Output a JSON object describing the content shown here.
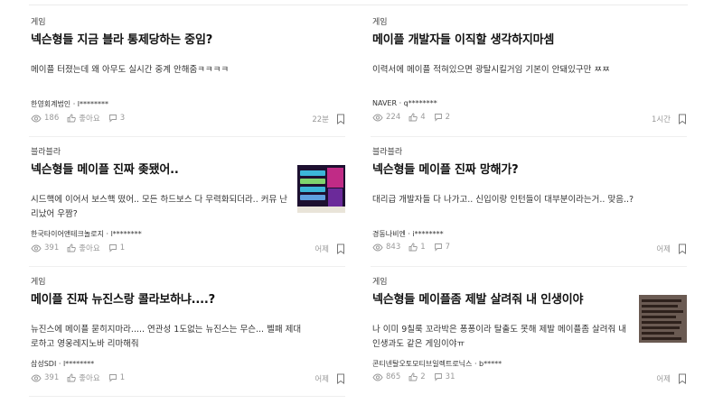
{
  "posts": [
    {
      "category": "게임",
      "title": "넥슨형들 지금 블라 통제당하는 중임?",
      "excerpt": "메이플 터졌는데 왜 아무도 실시간 중계 안해줌ㅋㅋㅋㅋ",
      "author": "한영회계법인 · l********",
      "views": "186",
      "likes": "좋아요",
      "comments": "3",
      "time": "22분"
    },
    {
      "category": "게임",
      "title": "메이플 개발자들 이직할 생각하지마셈",
      "excerpt": "이력서에 메이플 적혀있으면 광탈시킬거임 기본이 안돼있구만 ㅉㅉ",
      "author": "NAVER · q********",
      "views": "224",
      "likes": "4",
      "comments": "2",
      "time": "1시간"
    },
    {
      "category": "블라블라",
      "title": "넥슨형들 메이플 진짜 좆됐어..",
      "excerpt": "시드핵에 이어서 보스핵 떴어.. 모든 하드보스 다 무력화되더라.. 커뮤 난리났어 우짬?",
      "author": "한국타이어앤테크놀로지 · l********",
      "views": "391",
      "likes": "좋아요",
      "comments": "1",
      "time": "어제",
      "thumb": "game-screenshot"
    },
    {
      "category": "블라블라",
      "title": "넥슨형들 메이플 진짜 망해가?",
      "excerpt": "대리급 개발자들 다 나가고.. 신입이랑 인턴들이 대부분이라는거.. 맞음..?",
      "author": "경동나비엔 · i********",
      "views": "843",
      "likes": "1",
      "comments": "7",
      "time": "어제"
    },
    {
      "category": "게임",
      "title": "메이플 진짜 뉴진스랑 콜라보하냐....?",
      "excerpt": "뉴진스에 메이플 묻히지마라..... 연관성 1도없는 뉴진스는 무슨... 벨패 제대로하고 영웅레지노바 리마해줘",
      "author": "삼성SDI · l********",
      "views": "391",
      "likes": "좋아요",
      "comments": "1",
      "time": "어제"
    },
    {
      "category": "게임",
      "title": "넥슨형들 메이플좀 제발 살려줘 내 인생이야",
      "excerpt": "나 이미 9칠룩 꼬라박은 퐁퐁이라 탈출도 못해 제발 메이플좀 살려줘 내 인생과도 같은 게임이야ㅠ",
      "author": "콘티넨탈오토모티브일렉트로닉스 · b*****",
      "views": "865",
      "likes": "2",
      "comments": "31",
      "time": "어제",
      "thumb": "text-screenshot"
    }
  ]
}
